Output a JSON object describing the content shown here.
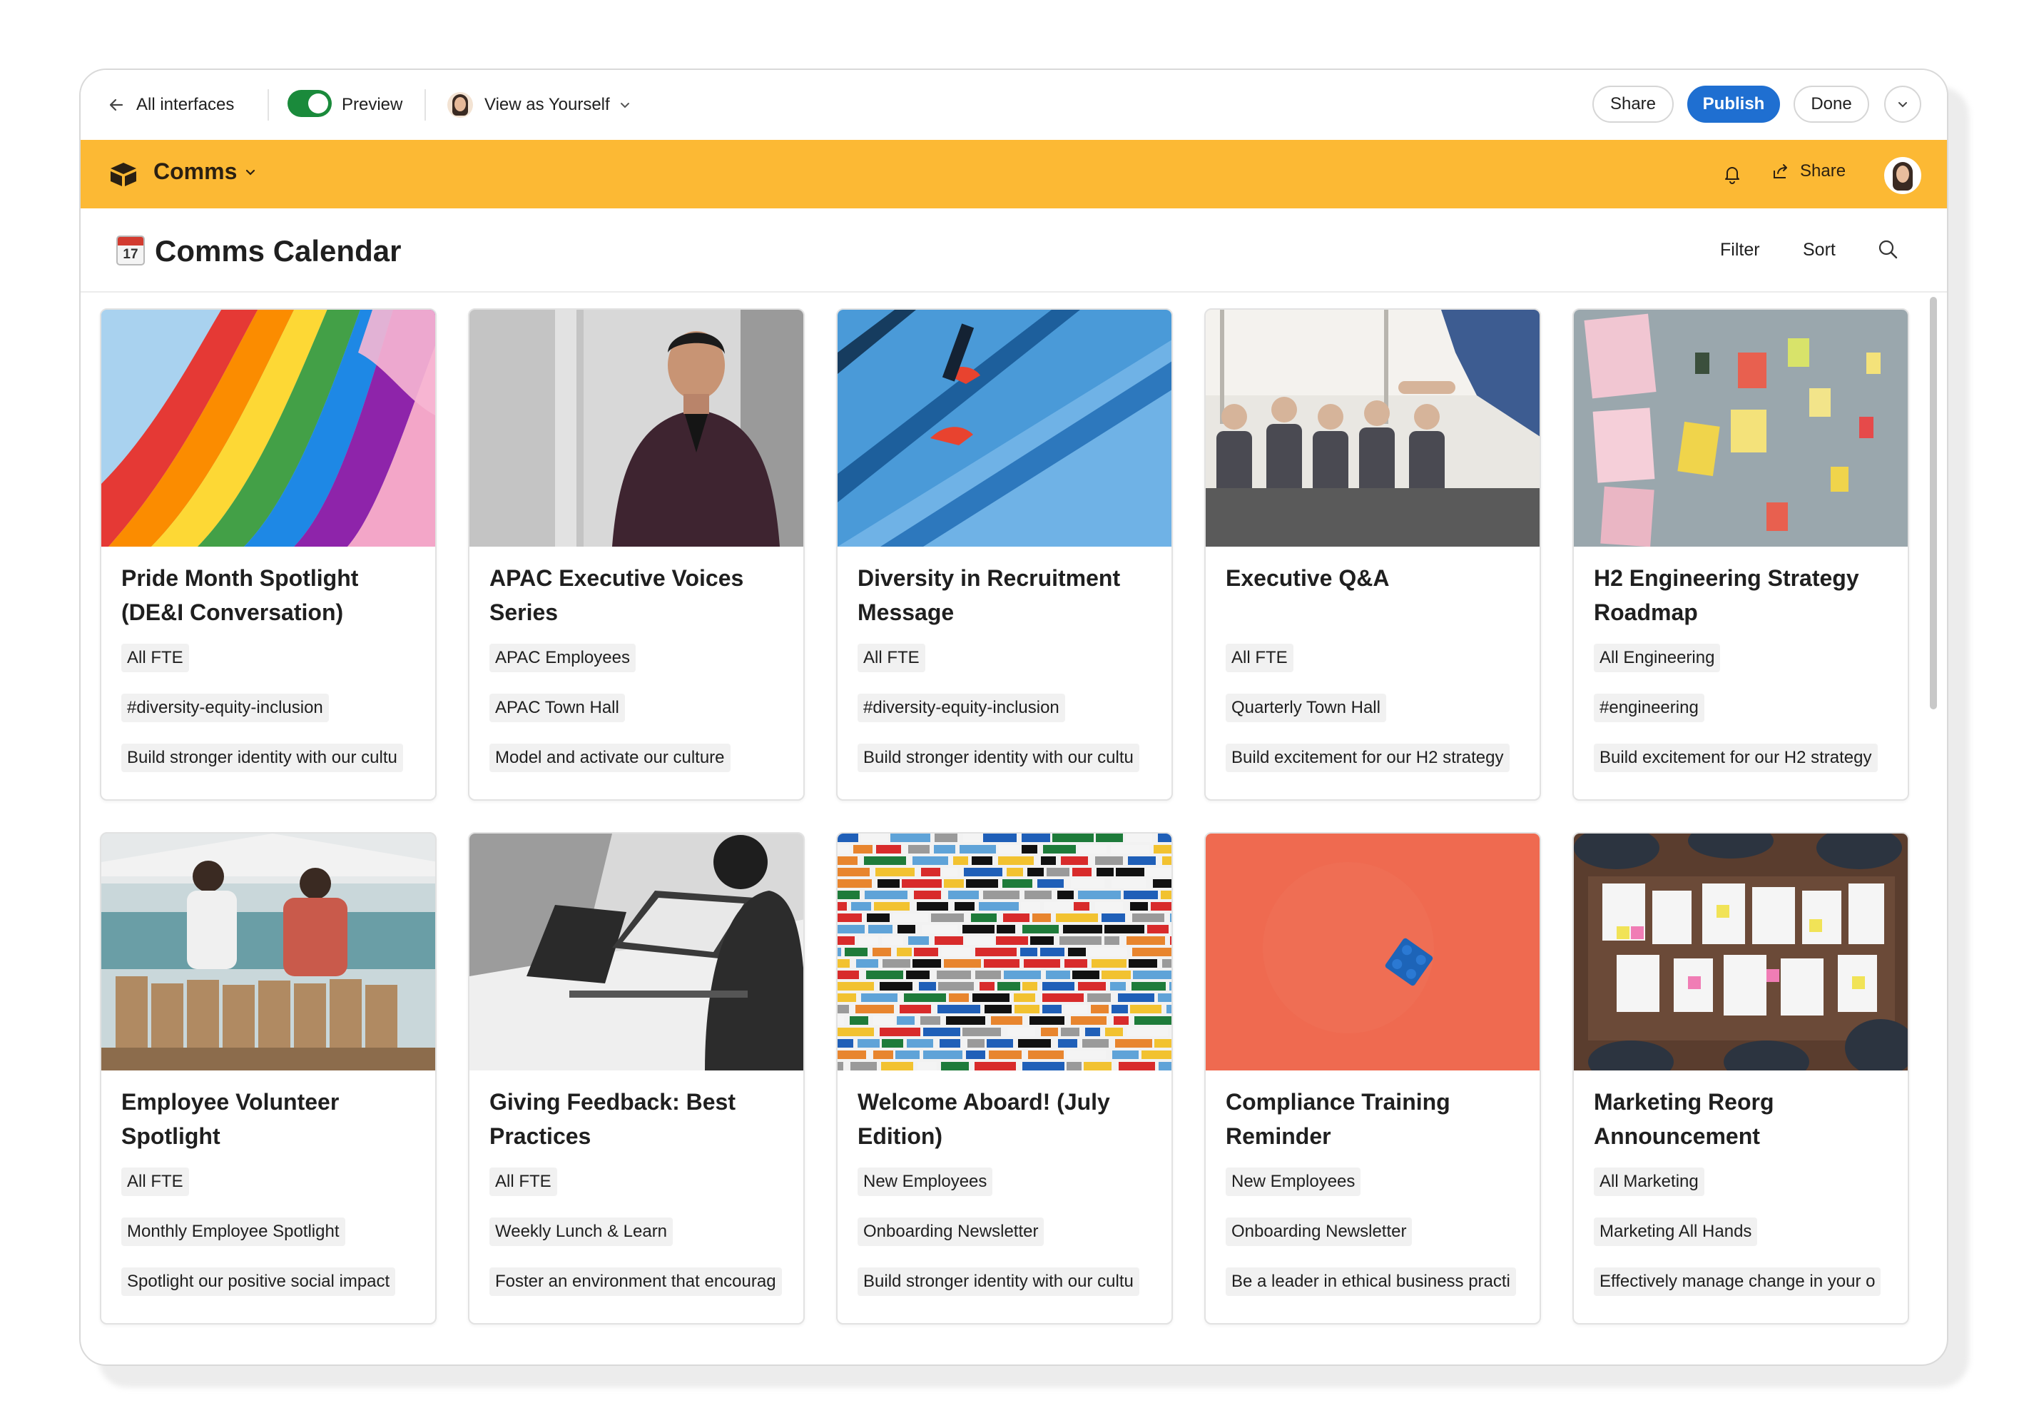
{
  "toolbar": {
    "back_label": "All interfaces",
    "preview_label": "Preview",
    "view_as_label": "View as Yourself",
    "share_label": "Share",
    "publish_label": "Publish",
    "done_label": "Done",
    "preview_on": true
  },
  "app": {
    "name": "Comms",
    "share_label": "Share",
    "accent_color": "#fcb934"
  },
  "page": {
    "calendar_day": "17",
    "title": "Comms Calendar",
    "filter_label": "Filter",
    "sort_label": "Sort"
  },
  "cards": [
    {
      "title_lines": [
        "Pride Month Spotlight",
        "(DE&I Conversation)"
      ],
      "tags": [
        "All FTE",
        "#diversity-equity-inclusion",
        "Build stronger identity with our cultu"
      ],
      "image": "rainbow-flag"
    },
    {
      "title_lines": [
        "APAC Executive Voices",
        "Series"
      ],
      "tags": [
        "APAC Employees",
        "APAC Town Hall",
        "Model and activate our culture"
      ],
      "image": "executive-portrait"
    },
    {
      "title_lines": [
        "Diversity in Recruitment",
        "Message"
      ],
      "tags": [
        "All FTE",
        "#diversity-equity-inclusion",
        "Build stronger identity with our cultu"
      ],
      "image": "blue-stairs"
    },
    {
      "title_lines": [
        "Executive Q&A",
        ""
      ],
      "tags": [
        "All FTE",
        "Quarterly Town Hall",
        "Build excitement for our H2 strategy"
      ],
      "image": "audience-meeting"
    },
    {
      "title_lines": [
        "H2 Engineering Strategy",
        "Roadmap"
      ],
      "tags": [
        "All Engineering",
        "#engineering",
        "Build excitement for our H2 strategy"
      ],
      "image": "sticky-notes-wall"
    },
    {
      "title_lines": [
        "Employee Volunteer",
        "Spotlight"
      ],
      "tags": [
        "All FTE",
        "Monthly Employee Spotlight",
        "Spotlight our positive social impact"
      ],
      "image": "volunteers-packing"
    },
    {
      "title_lines": [
        "Giving Feedback: Best",
        "Practices"
      ],
      "tags": [
        "All FTE",
        "Weekly Lunch & Learn",
        "Foster an environment that encourag"
      ],
      "image": "laptop-desk"
    },
    {
      "title_lines": [
        "Welcome Aboard! (July",
        "Edition)"
      ],
      "tags": [
        "New Employees",
        "Onboarding Newsletter",
        "Build stronger identity with our cultu"
      ],
      "image": "colorful-bricks"
    },
    {
      "title_lines": [
        "Compliance Training",
        "Reminder"
      ],
      "tags": [
        "New Employees",
        "Onboarding Newsletter",
        "Be a leader in ethical business practi"
      ],
      "image": "blue-brick-on-red"
    },
    {
      "title_lines": [
        "Marketing Reorg",
        "Announcement"
      ],
      "tags": [
        "All Marketing",
        "Marketing All Hands",
        "Effectively manage change in your o"
      ],
      "image": "team-planning-table"
    }
  ]
}
